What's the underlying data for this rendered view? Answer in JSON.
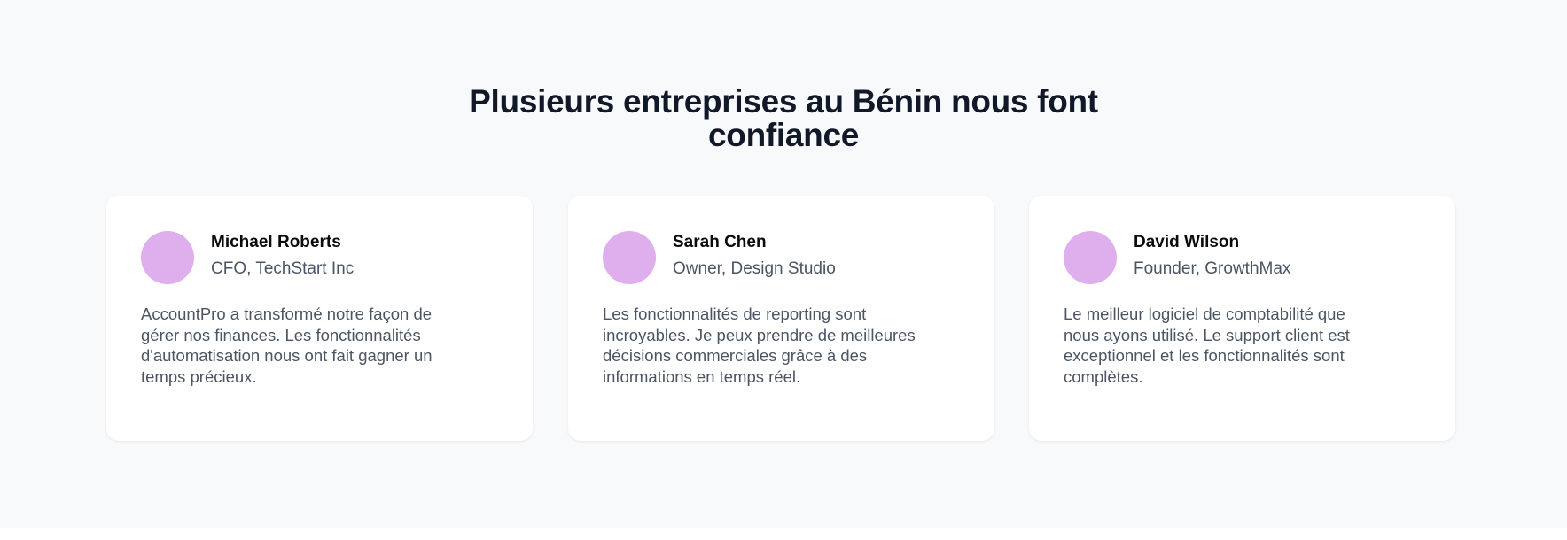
{
  "section": {
    "title_line1": "Plusieurs entreprises au Bénin nous font",
    "title_line2": "confiance"
  },
  "colors": {
    "avatar": "#dfaeec",
    "section_background": "#f8f9fb",
    "heading": "#111827",
    "body_text": "#4b5563"
  },
  "testimonials": [
    {
      "avatar_icon": "avatar-placeholder-circle",
      "name": "Michael Roberts",
      "role": "CFO, TechStart Inc",
      "quote": "AccountPro a transformé notre façon de gérer nos finances. Les fonctionnalités d'automatisation nous ont fait gagner un temps précieux."
    },
    {
      "avatar_icon": "avatar-placeholder-circle",
      "name": "Sarah Chen",
      "role": "Owner, Design Studio",
      "quote": "Les fonctionnalités de reporting sont incroyables. Je peux prendre de meilleures décisions commerciales grâce à des informations en temps réel."
    },
    {
      "avatar_icon": "avatar-placeholder-circle",
      "name": "David Wilson",
      "role": "Founder, GrowthMax",
      "quote": "Le meilleur logiciel de comptabilité que nous ayons utilisé. Le support client est exceptionnel et les fonctionnalités sont complètes."
    }
  ]
}
